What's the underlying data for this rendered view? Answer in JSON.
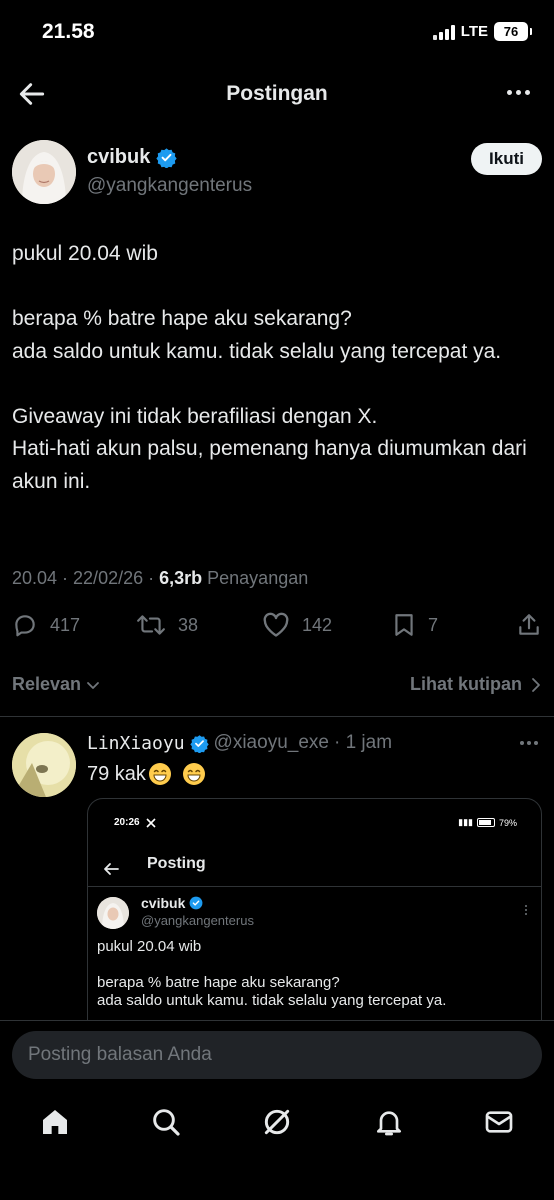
{
  "status_bar": {
    "time": "21.58",
    "network": "LTE",
    "battery": "76"
  },
  "header": {
    "title": "Postingan"
  },
  "author": {
    "name": "cvibuk",
    "handle": "@yangkangenterus",
    "follow_label": "Ikuti"
  },
  "tweet": {
    "text": "pukul 20.04 wib\n\nberapa % batre hape aku sekarang?\nada saldo untuk kamu. tidak selalu yang tercepat ya.\n\nGiveaway ini tidak berafiliasi dengan X.\nHati-hati akun palsu, pemenang hanya diumumkan dari akun ini.",
    "timestamp": "20.04 · 22/02/26 · ",
    "views": "6,3rb",
    "views_label": " Penayangan"
  },
  "actions": {
    "replies": "417",
    "reposts": "38",
    "likes": "142",
    "bookmarks": "7"
  },
  "sort": {
    "label": "Relevan",
    "quotes_link": "Lihat kutipan"
  },
  "reply": {
    "name": "LinXiaoyu",
    "handle": "@xiaoyu_exe",
    "time": "· 1 jam",
    "text": "79 kak",
    "embed": {
      "time": "20:26",
      "battery": "79%",
      "title": "Posting",
      "name": "cvibuk",
      "handle": "@yangkangenterus",
      "text": "pukul 20.04 wib\n\nberapa % batre hape aku sekarang?\nada saldo untuk kamu. tidak selalu yang tercepat ya."
    }
  },
  "compose": {
    "placeholder": "Posting balasan Anda"
  },
  "nav": {
    "items": [
      "home-icon",
      "search-icon",
      "grok-icon",
      "notifications-icon",
      "messages-icon"
    ]
  },
  "colors": {
    "background": "#000000",
    "text": "#e7e9ea",
    "muted": "#71767b",
    "verified": "#1d9bf0",
    "divider": "#2f3336"
  }
}
